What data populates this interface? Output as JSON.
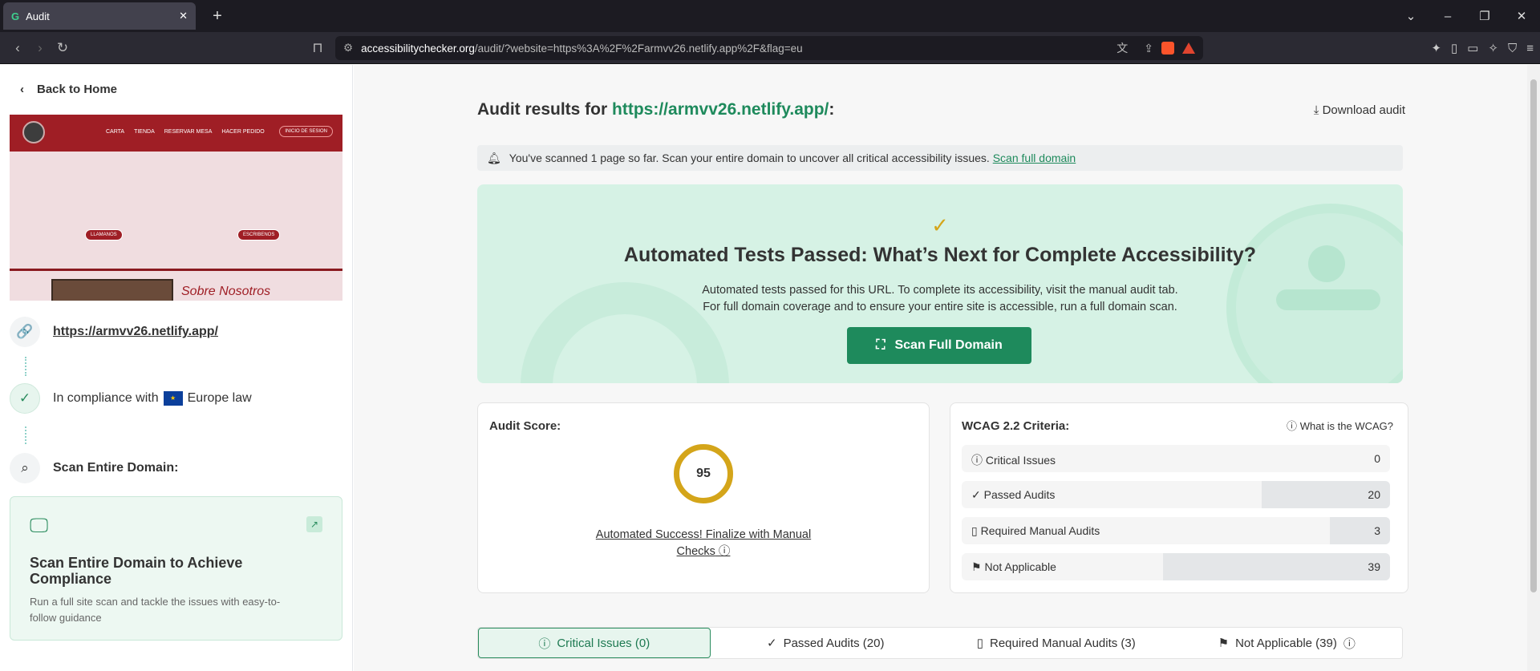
{
  "browser": {
    "tab_title": "Audit",
    "url_domain": "accessibilitychecker.org",
    "url_rest": "/audit/?website=https%3A%2F%2Farmvv26.netlify.app%2F&flag=eu"
  },
  "sidebar": {
    "back_label": "Back to Home",
    "thumbnail": {
      "nav_links": [
        "CARTA",
        "TIENDA",
        "RESERVAR MESA",
        "HACER PEDIDO"
      ],
      "login": "INICIO DE SESION",
      "pill_left": "LLAMANOS",
      "pill_right": "ESCRIBENOS",
      "heading": "Sobre Nosotros"
    },
    "site_url": "https://armvv26.netlify.app/",
    "compliance_prefix": "In compliance with",
    "compliance_law": "Europe law",
    "scan_domain_label": "Scan Entire Domain:",
    "card": {
      "title": "Scan Entire Domain to Achieve Compliance",
      "desc": "Run a full site scan and tackle the issues with easy-to-follow guidance"
    }
  },
  "main": {
    "heading_prefix": "Audit results for",
    "heading_url": "https://armvv26.netlify.app/",
    "heading_suffix": ":",
    "download": "Download audit",
    "notice_text": "You've scanned 1 page so far. Scan your entire domain to uncover all critical accessibility issues.",
    "notice_link": "Scan full domain",
    "hero": {
      "title": "Automated Tests Passed: What’s Next for Complete Accessibility?",
      "line1": "Automated tests passed for this URL. To complete its accessibility, visit the manual audit tab.",
      "line2": "For full domain coverage and to ensure your entire site is accessible, run a full domain scan.",
      "button": "Scan Full Domain"
    },
    "score": {
      "title": "Audit Score:",
      "value": "95",
      "value_fraction": 0.95,
      "message_1": "Automated Success! Finalize with Manual",
      "message_2": "Checks"
    },
    "wcag": {
      "title": "WCAG 2.2 Criteria:",
      "what": "What is the WCAG?",
      "rows": [
        {
          "label": "Critical Issues",
          "value": "0",
          "fill": 0
        },
        {
          "label": "Passed Audits",
          "value": "20",
          "fill": 0.3
        },
        {
          "label": "Required Manual Audits",
          "value": "3",
          "fill": 0.14
        },
        {
          "label": "Not Applicable",
          "value": "39",
          "fill": 0.53
        }
      ]
    },
    "tabs": [
      {
        "label": "Critical Issues (0)"
      },
      {
        "label": "Passed Audits (20)"
      },
      {
        "label": "Required Manual Audits (3)"
      },
      {
        "label": "Not Applicable (39)"
      }
    ]
  },
  "colors": {
    "accent": "#1e8a5c",
    "score": "#d4a51a",
    "hero_bg": "#d6f2e5"
  }
}
